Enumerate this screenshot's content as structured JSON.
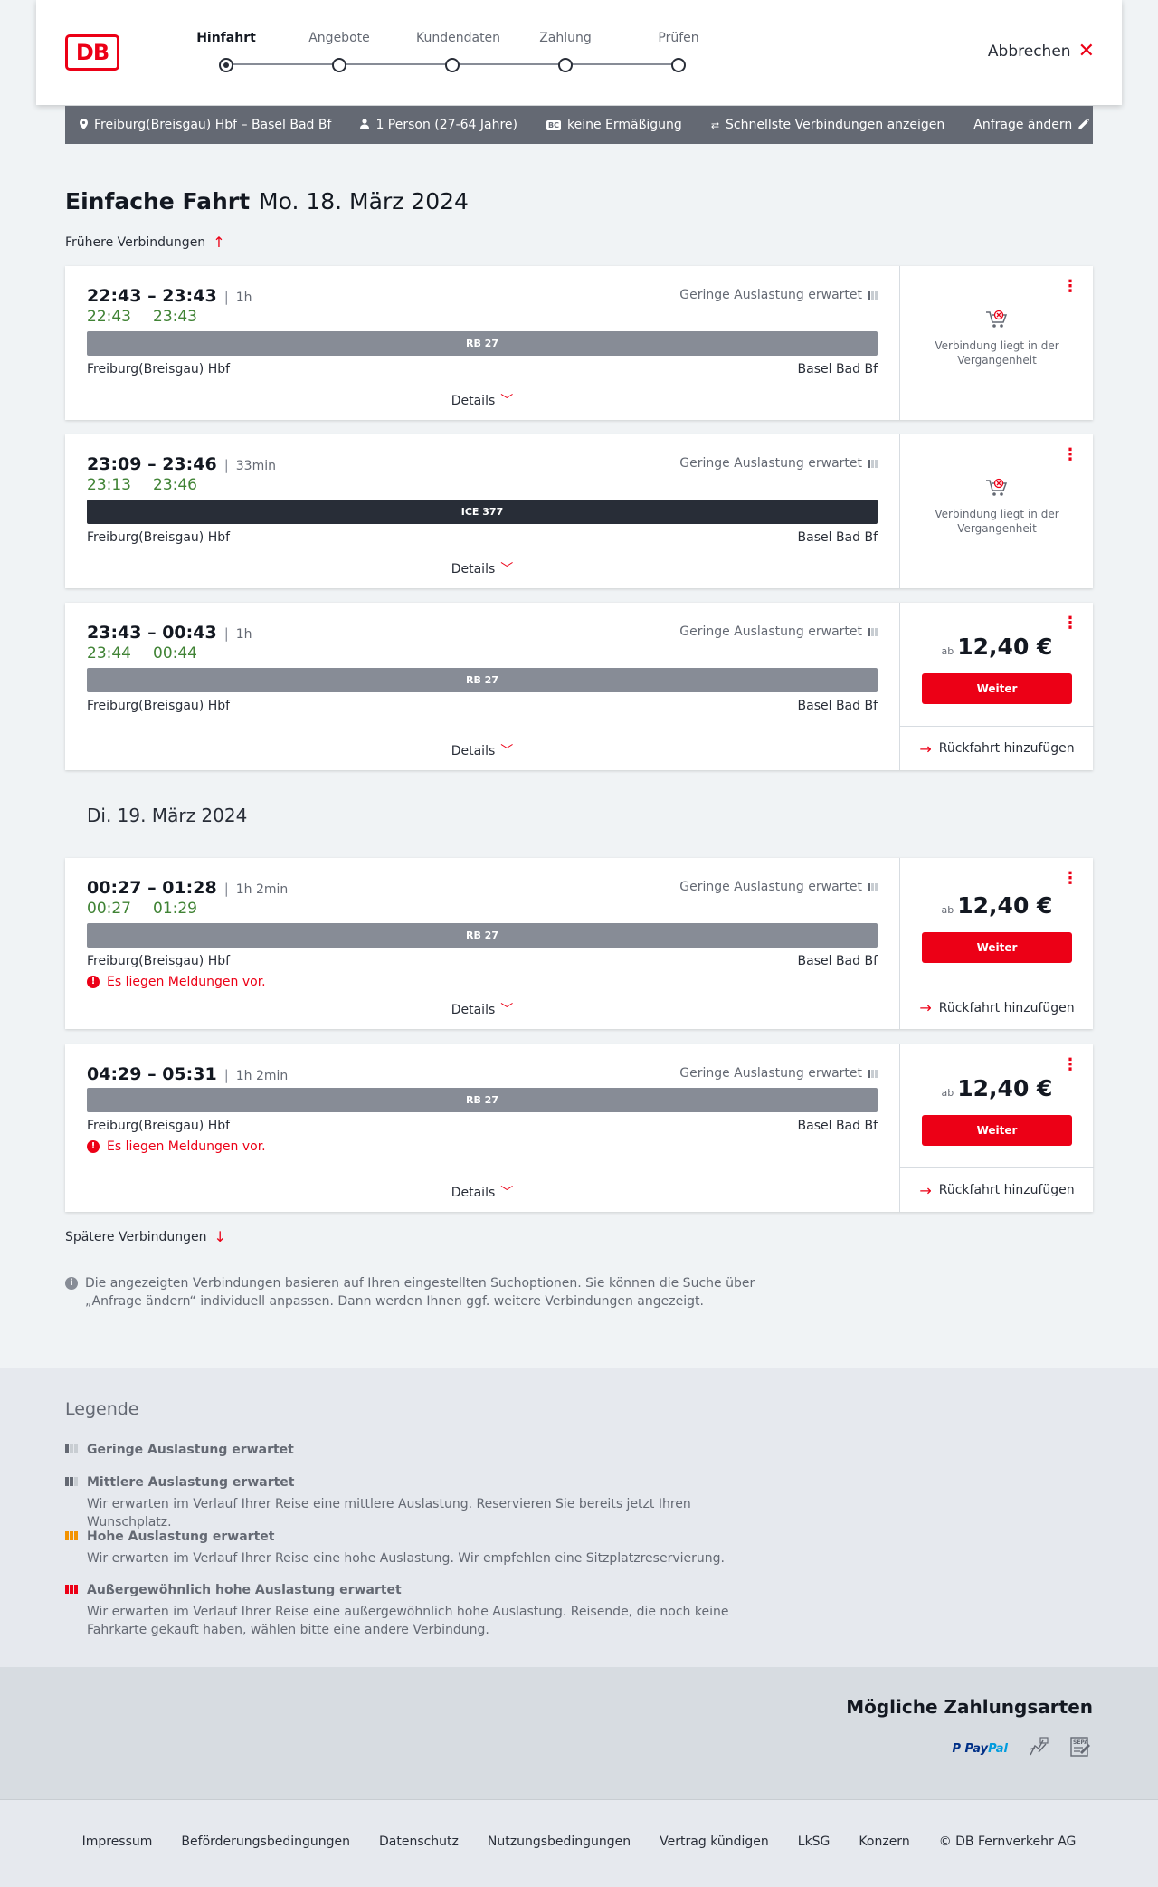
{
  "header": {
    "logo": "DB",
    "steps": [
      {
        "label": "Hinfahrt",
        "active": true
      },
      {
        "label": "Angebote",
        "active": false
      },
      {
        "label": "Kundendaten",
        "active": false
      },
      {
        "label": "Zahlung",
        "active": false
      },
      {
        "label": "Prüfen",
        "active": false
      }
    ],
    "cancel_label": "Abbrechen"
  },
  "filters": {
    "route": "Freiburg(Breisgau) Hbf – Basel Bad Bf",
    "travellers": "1 Person (27-64 Jahre)",
    "discount_badge": "BC",
    "discount": "keine Ermäßigung",
    "option": "Schnellste Verbindungen anzeigen",
    "edit": "Anfrage ändern"
  },
  "heading": {
    "title": "Einfache Fahrt",
    "date": "Mo. 18. März 2024"
  },
  "earlier_label": "Frühere Verbindungen",
  "later_label": "Spätere Verbindungen",
  "day2_label": "Di. 19. März 2024",
  "common": {
    "load_label": "Geringe Auslastung erwartet",
    "details_label": "Details",
    "past_text": "Verbindung liegt in der Vergangenheit",
    "price_prefix": "ab",
    "weiter_label": "Weiter",
    "return_label": "Rückfahrt hinzufügen",
    "message_text": "Es liegen Meldungen vor."
  },
  "connections": [
    {
      "times": "22:43 – 23:43",
      "duration": "1h",
      "rt_dep": "22:43",
      "rt_arr": "23:43",
      "train": "RB 27",
      "from": "Freiburg(Breisgau) Hbf",
      "to": "Basel Bad Bf",
      "status": "past"
    },
    {
      "times": "23:09 – 23:46",
      "duration": "33min",
      "rt_dep": "23:13",
      "rt_arr": "23:46",
      "train": "ICE 377",
      "from": "Freiburg(Breisgau) Hbf",
      "to": "Basel Bad Bf",
      "status": "past"
    },
    {
      "times": "23:43 – 00:43",
      "duration": "1h",
      "rt_dep": "23:44",
      "rt_arr": "00:44",
      "train": "RB 27",
      "from": "Freiburg(Breisgau) Hbf",
      "to": "Basel Bad Bf",
      "status": "bookable",
      "price": "12,40 €"
    },
    {
      "times": "00:27 – 01:28",
      "duration": "1h 2min",
      "rt_dep": "00:27",
      "rt_arr": "01:29",
      "train": "RB 27",
      "from": "Freiburg(Breisgau) Hbf",
      "to": "Basel Bad Bf",
      "status": "bookable",
      "price": "12,40 €",
      "message": true
    },
    {
      "times": "04:29 – 05:31",
      "duration": "1h 2min",
      "train": "RB 27",
      "from": "Freiburg(Breisgau) Hbf",
      "to": "Basel Bad Bf",
      "status": "bookable",
      "price": "12,40 €",
      "message": true
    }
  ],
  "info_text": "Die angezeigten Verbindungen basieren auf Ihren eingestellten Suchoptionen. Sie können die Suche über „Anfrage ändern“ individuell anpassen. Dann werden Ihnen ggf. weitere Verbindungen angezeigt.",
  "legend": {
    "title": "Legende",
    "items": [
      {
        "title": "Geringe Auslastung erwartet",
        "text": ""
      },
      {
        "title": "Mittlere Auslastung erwartet",
        "text": "Wir erwarten im Verlauf Ihrer Reise eine mittlere Auslastung. Reservieren Sie bereits jetzt Ihren Wunschplatz."
      },
      {
        "title": "Hohe Auslastung erwartet",
        "text": "Wir erwarten im Verlauf Ihrer Reise eine hohe Auslastung. Wir empfehlen eine Sitzplatzreservierung."
      },
      {
        "title": "Außergewöhnlich hohe Auslastung erwartet",
        "text": "Wir erwarten im Verlauf Ihrer Reise eine außergewöhnlich hohe Auslastung. Reisende, die noch keine Fahrkarte gekauft haben, wählen bitte eine andere Verbindung."
      }
    ]
  },
  "payment": {
    "title": "Mögliche Zahlungsarten",
    "paypal_a": "Pay",
    "paypal_b": "Pal",
    "sepa": "SEPA"
  },
  "footer": {
    "links": [
      "Impressum",
      "Beförderungsbedingungen",
      "Datenschutz",
      "Nutzungsbedingungen",
      "Vertrag kündigen",
      "LkSG",
      "Konzern",
      "© DB Fernverkehr AG"
    ]
  },
  "colors": {
    "brand_red": "#ec0016",
    "realtime_green": "#408335",
    "filter_bar": "#646973"
  }
}
